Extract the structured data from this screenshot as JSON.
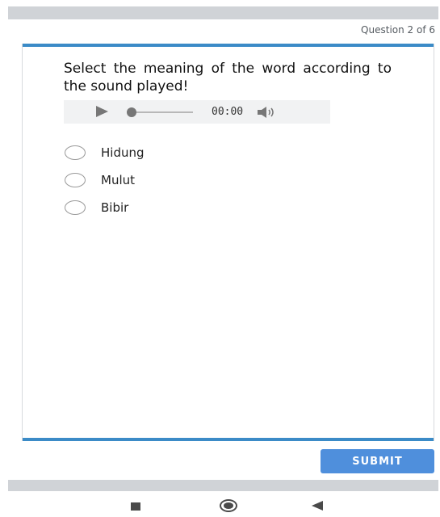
{
  "header": {
    "question_counter": "Question 2 of 6"
  },
  "question": {
    "prompt": "Select the meaning of the word according to the sound played!"
  },
  "audio_player": {
    "time": "00:00",
    "progress_fraction": 0
  },
  "options": [
    {
      "label": "Hidung",
      "selected": false
    },
    {
      "label": "Mulut",
      "selected": false
    },
    {
      "label": "Bibir",
      "selected": false
    }
  ],
  "actions": {
    "submit_label": "SUBMIT"
  },
  "colors": {
    "accent_bar": "#3b8bc7",
    "submit_button": "#4f8fdc",
    "system_bar": "#d0d3d7"
  },
  "icons": {
    "play": "play-icon",
    "volume": "volume-icon",
    "nav_recents": "square-icon",
    "nav_home": "circle-icon",
    "nav_back": "triangle-back-icon"
  }
}
